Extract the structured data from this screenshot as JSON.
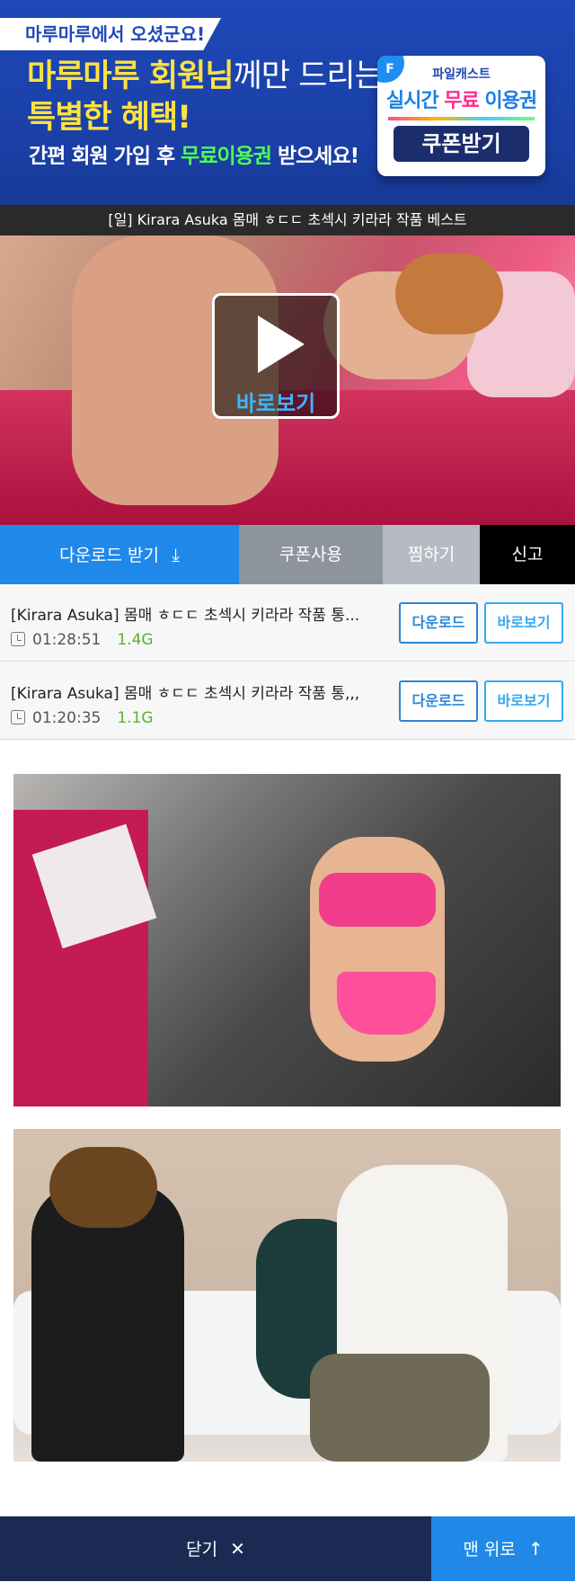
{
  "banner": {
    "tag": "마루마루에서 오셨군요!",
    "headline_bold": "마루마루 회원님",
    "headline_light": "께만 드리는",
    "headline_line2": "특별한 혜택!",
    "sub_prefix": "간편 회원 가입 후 ",
    "sub_highlight": "무료이용권",
    "sub_suffix": " 받으세요!",
    "card_brand": "파일캐스트",
    "card_title_a": "실시간 ",
    "card_title_b": "무료",
    "card_title_c": " 이용권",
    "card_button": "쿠폰받기",
    "card_badge": "F"
  },
  "video": {
    "title": "[일] Kirara Asuka 몸매 ㅎㄷㄷ 초섹시 키라라 작품 베스트",
    "play_label": "바로보기"
  },
  "actions": {
    "download": "다운로드 받기",
    "download_icon": "⤓",
    "coupon": "쿠폰사용",
    "like": "찜하기",
    "report": "신고"
  },
  "files": [
    {
      "name": "[Kirara Asuka] 몸매 ㅎㄷㄷ 초섹시 키라라 작품 통...",
      "duration": "01:28:51",
      "size": "1.4G",
      "download": "다운로드",
      "view": "바로보기"
    },
    {
      "name": "[Kirara Asuka] 몸매 ㅎㄷㄷ 초섹시 키라라 작품 통,,,",
      "duration": "01:20:35",
      "size": "1.1G",
      "download": "다운로드",
      "view": "바로보기"
    }
  ],
  "footer": {
    "close": "닫기",
    "close_icon": "✕",
    "top": "맨 위로",
    "top_icon": "↑"
  },
  "colors": {
    "primary": "#2088e8",
    "banner": "#1f49b8",
    "footer": "#1a2a53",
    "size_green": "#5bb032"
  }
}
